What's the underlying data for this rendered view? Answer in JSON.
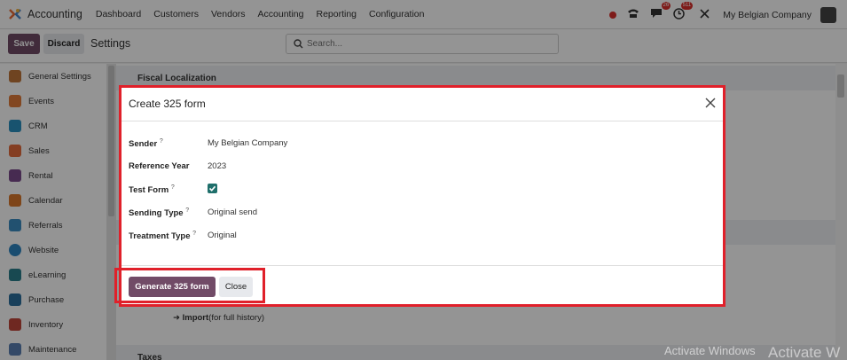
{
  "navbar": {
    "app_title": "Accounting",
    "menu": [
      "Dashboard",
      "Customers",
      "Vendors",
      "Accounting",
      "Reporting",
      "Configuration"
    ],
    "messages_count": "26",
    "activities_count": "511",
    "company": "My Belgian Company"
  },
  "control": {
    "save_label": "Save",
    "discard_label": "Discard",
    "title": "Settings",
    "search_placeholder": "Search..."
  },
  "sidebar": {
    "items": [
      {
        "label": "General Settings",
        "icon": "general-settings-icon",
        "color": "#c0763a"
      },
      {
        "label": "Events",
        "icon": "events-icon",
        "color": "#e07b39"
      },
      {
        "label": "CRM",
        "icon": "crm-icon",
        "color": "#2a8fbf"
      },
      {
        "label": "Sales",
        "icon": "sales-icon",
        "color": "#e36b3d"
      },
      {
        "label": "Rental",
        "icon": "rental-icon",
        "color": "#7a4a8c"
      },
      {
        "label": "Calendar",
        "icon": "calendar-icon",
        "color": "#d9772c"
      },
      {
        "label": "Referrals",
        "icon": "referrals-icon",
        "color": "#3b8cc1"
      },
      {
        "label": "Website",
        "icon": "website-icon",
        "color": "#2e86c1"
      },
      {
        "label": "eLearning",
        "icon": "elearning-icon",
        "color": "#2a7f8c"
      },
      {
        "label": "Purchase",
        "icon": "purchase-icon",
        "color": "#2b6f9e"
      },
      {
        "label": "Inventory",
        "icon": "inventory-icon",
        "color": "#c0463a"
      },
      {
        "label": "Maintenance",
        "icon": "maintenance-icon",
        "color": "#5b7fb2"
      }
    ]
  },
  "content": {
    "section_fiscal": "Fiscal Localization",
    "section_taxes": "Taxes",
    "import_label": "Import",
    "import_hint": "(for full history)"
  },
  "dialog": {
    "title": "Create 325 form",
    "fields": [
      {
        "label": "Sender",
        "help": "?",
        "value": "My Belgian Company"
      },
      {
        "label": "Reference Year",
        "help": "",
        "value": "2023"
      },
      {
        "label": "Test Form",
        "help": "?",
        "checked": true
      },
      {
        "label": "Sending Type",
        "help": "?",
        "value": "Original send"
      },
      {
        "label": "Treatment Type",
        "help": "?",
        "value": "Original"
      }
    ],
    "generate_label": "Generate 325 form",
    "close_label": "Close"
  },
  "watermark": {
    "text": "Activate Windows",
    "text2": "Activate W"
  },
  "colors": {
    "brand": "#714b67",
    "highlight": "#e0202a",
    "check": "#1f6f6b"
  }
}
